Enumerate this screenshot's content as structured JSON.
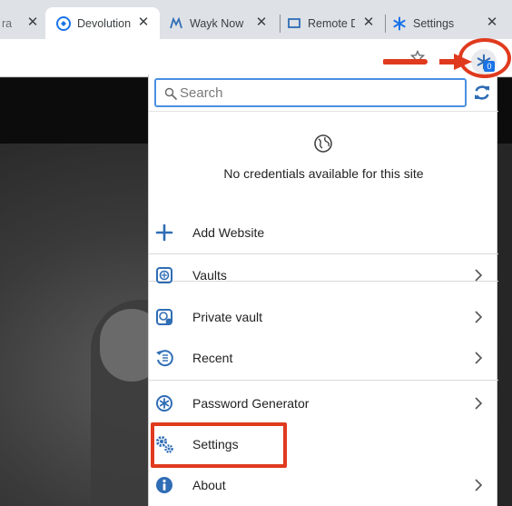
{
  "tabs": [
    {
      "title": "ra",
      "active": false
    },
    {
      "title": "Devolution",
      "active": true,
      "icon": "devolutions-logo-icon"
    },
    {
      "title": "Wayk Now",
      "active": false,
      "icon": "wayk-icon"
    },
    {
      "title": "Remote D",
      "active": false,
      "icon": "remote-desktop-icon"
    },
    {
      "title": "Settings",
      "active": false,
      "icon": "snowflake-icon"
    }
  ],
  "toolbar": {
    "extension_badge": "0"
  },
  "popup": {
    "search_placeholder": "Search",
    "empty_message": "No credentials available for this site",
    "menu": {
      "add_website": "Add Website",
      "vaults": "Vaults",
      "private_vault": "Private vault",
      "recent": "Recent",
      "password_generator": "Password Generator",
      "settings": "Settings",
      "about": "About"
    }
  },
  "colors": {
    "accent_blue": "#1a73e8",
    "icon_blue": "#2f6db5",
    "annotation_red": "#e03a1e"
  }
}
